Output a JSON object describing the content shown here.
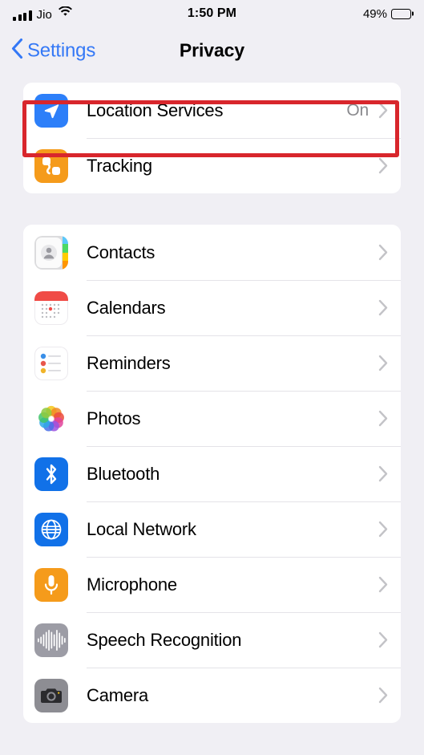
{
  "status_bar": {
    "carrier": "Jio",
    "signal_icon": "cellular-bars-icon",
    "wifi_icon": "wifi-icon",
    "time": "1:50 PM",
    "battery_percent": "49%",
    "battery_level": 49,
    "battery_icon": "battery-icon"
  },
  "nav": {
    "back_label": "Settings",
    "back_icon": "chevron-left-icon",
    "title": "Privacy"
  },
  "colors": {
    "background": "#f0eff4",
    "card": "#ffffff",
    "accent_blue": "#3478f6",
    "highlight_red": "#d8262c",
    "value_gray": "#8a8a8e",
    "separator": "#e4e3e8"
  },
  "highlight": {
    "target": "Location Services",
    "color": "#d8262c"
  },
  "groups": [
    {
      "rows": [
        {
          "label": "Location Services",
          "value": "On",
          "icon": "location-arrow-icon",
          "icon_class": "ic-location",
          "highlighted": true
        },
        {
          "label": "Tracking",
          "value": "",
          "icon": "tracking-icon",
          "icon_class": "ic-tracking",
          "highlighted": false
        }
      ]
    },
    {
      "rows": [
        {
          "label": "Contacts",
          "value": "",
          "icon": "contacts-icon",
          "icon_class": "ic-contacts",
          "highlighted": false
        },
        {
          "label": "Calendars",
          "value": "",
          "icon": "calendar-icon",
          "icon_class": "ic-calendars",
          "highlighted": false
        },
        {
          "label": "Reminders",
          "value": "",
          "icon": "reminders-icon",
          "icon_class": "ic-reminders",
          "highlighted": false
        },
        {
          "label": "Photos",
          "value": "",
          "icon": "photos-icon",
          "icon_class": "ic-photos",
          "highlighted": false
        },
        {
          "label": "Bluetooth",
          "value": "",
          "icon": "bluetooth-icon",
          "icon_class": "ic-bluetooth",
          "highlighted": false
        },
        {
          "label": "Local Network",
          "value": "",
          "icon": "globe-icon",
          "icon_class": "ic-network",
          "highlighted": false
        },
        {
          "label": "Microphone",
          "value": "",
          "icon": "microphone-icon",
          "icon_class": "ic-mic",
          "highlighted": false
        },
        {
          "label": "Speech Recognition",
          "value": "",
          "icon": "waveform-icon",
          "icon_class": "ic-speech",
          "highlighted": false
        },
        {
          "label": "Camera",
          "value": "",
          "icon": "camera-icon",
          "icon_class": "ic-camera",
          "highlighted": false
        }
      ]
    }
  ]
}
